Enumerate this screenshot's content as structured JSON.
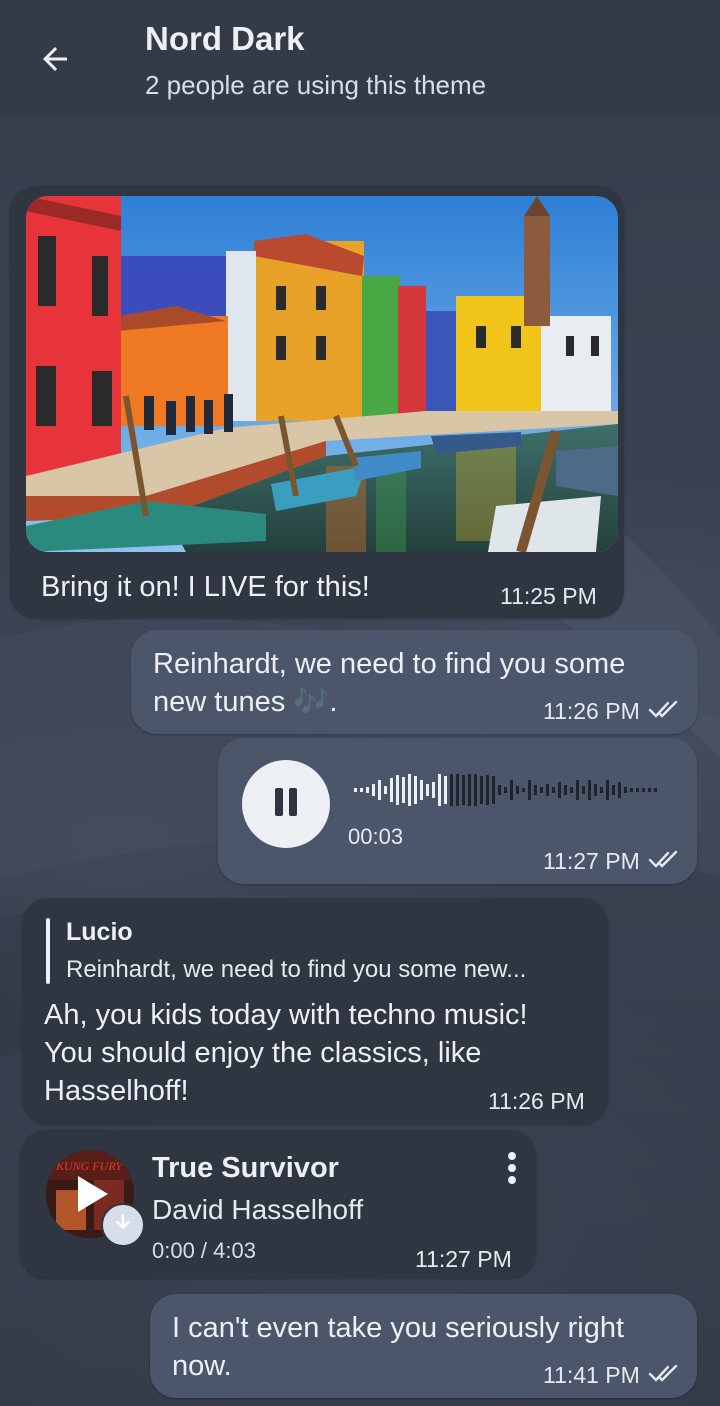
{
  "header": {
    "title": "Nord Dark",
    "subtitle": "2 people are using this theme"
  },
  "messages": {
    "photo_msg": {
      "text": "Bring it on! I LIVE for this!",
      "time": "11:25 PM"
    },
    "tunes_msg": {
      "line1": "Reinhardt, we need to find you some",
      "line2": "new tunes 🎶.",
      "time": "11:26 PM"
    },
    "voice_msg": {
      "duration": "00:03",
      "time": "11:27 PM"
    },
    "reply_msg": {
      "reply_author": "Lucio",
      "reply_preview": "Reinhardt, we need to find you some new...",
      "line1": "Ah, you kids today with techno music!",
      "line2": "You should enjoy the classics, like",
      "line3": "Hasselhoff!",
      "time": "11:26 PM"
    },
    "music_msg": {
      "track_title": "True Survivor",
      "artist": "David Hasselhoff",
      "progress": "0:00 / 4:03",
      "time": "11:27 PM"
    },
    "last_msg": {
      "line1": "I can't even take you seriously right",
      "line2": "now.",
      "time": "11:41 PM"
    }
  },
  "colors": {
    "background": "#2e3440",
    "incoming_bubble": "#2f3541",
    "outgoing_bubble": "#4c566a",
    "text": "#eceff4"
  },
  "icons": [
    "back-arrow-icon",
    "pause-icon",
    "play-icon",
    "download-icon",
    "more-vert-icon",
    "double-check-icon"
  ]
}
